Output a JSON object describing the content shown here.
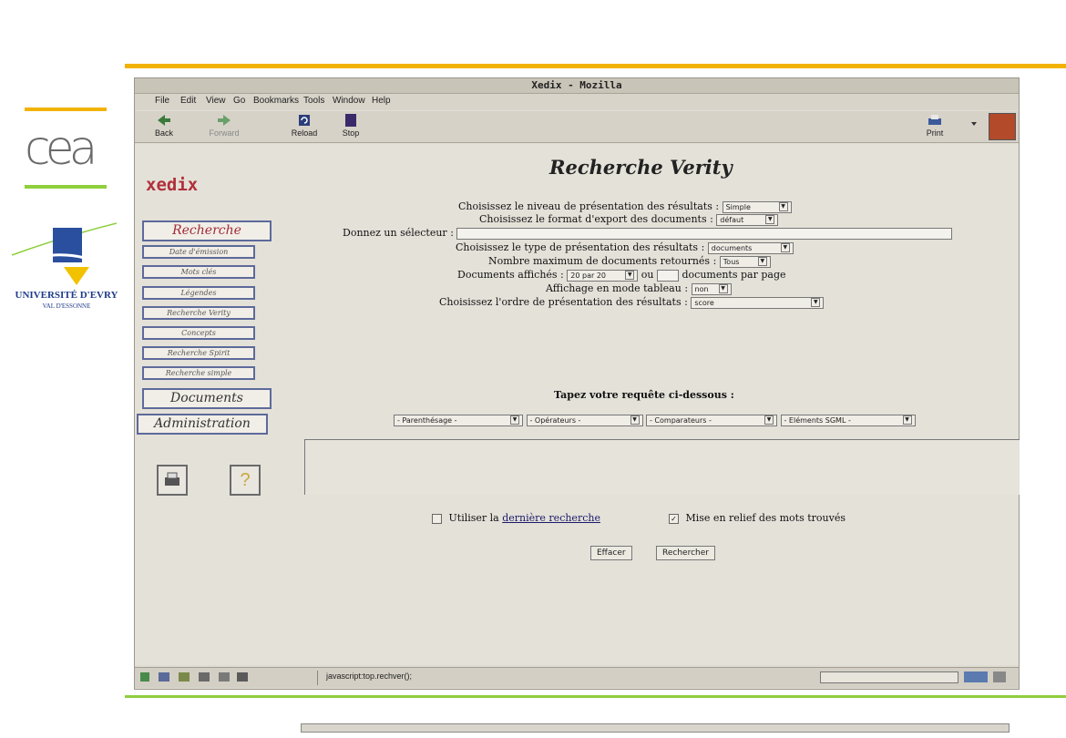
{
  "slide": {
    "logo_cea": "cea",
    "logo_univ_name": "UNIVERSITÉ D'EVRY",
    "logo_univ_sub": "VAL D'ESSONNE",
    "accent_gold": "#f2b200",
    "accent_green": "#8fcf3c"
  },
  "window": {
    "title": "Xedix - Mozilla",
    "menu": [
      "File",
      "Edit",
      "View",
      "Go",
      "Bookmarks",
      "Tools",
      "Window",
      "Help"
    ],
    "toolbar": {
      "back": "Back",
      "forward": "Forward",
      "reload": "Reload",
      "stop": "Stop",
      "print": "Print"
    },
    "status_text": "javascript:top.rechver();"
  },
  "sidebar": {
    "brand": "xedix",
    "nav_recherche": "Recherche",
    "sub_items": [
      "Date d'émission",
      "Mots clés",
      "Légendes",
      "Recherche Verity",
      "Concepts",
      "Recherche Spirit",
      "Recherche simple"
    ],
    "nav_documents": "Documents",
    "nav_administration": "Administration",
    "icons": [
      "printer-icon",
      "help-icon"
    ],
    "help_glyph": "?"
  },
  "form": {
    "heading": "Recherche Verity",
    "niveau_label": "Choisissez le niveau de présentation des résultats :",
    "niveau_value": "Simple",
    "format_label": "Choisissez le format d'export des documents :",
    "format_value": "défaut",
    "selecteur_label": "Donnez un sélecteur :",
    "type_label": "Choisissez le type de présentation des résultats :",
    "type_value": "documents",
    "max_label": "Nombre maximum de documents retournés :",
    "max_value": "Tous",
    "affiches_label": "Documents affichés :",
    "affiches_value": "20 par 20",
    "ou_label": "ou",
    "par_page_label": "documents par page",
    "tableau_label": "Affichage en mode tableau :",
    "tableau_value": "non",
    "ordre_label": "Choisissez l'ordre de présentation des résultats :",
    "ordre_value": "score",
    "requete_label": "Tapez votre requête ci-dessous :",
    "helpers": [
      "- Parenthésage -",
      "- Opérateurs -",
      "- Comparateurs -",
      "- Eléments SGML -"
    ],
    "utiliser_label": "Utiliser la",
    "utiliser_link": "dernière recherche",
    "utiliser_checked": false,
    "relief_label": "Mise en relief des mots trouvés",
    "relief_checked": true,
    "relief_mark": "✓",
    "effacer_button": "Effacer",
    "rechercher_button": "Rechercher"
  }
}
